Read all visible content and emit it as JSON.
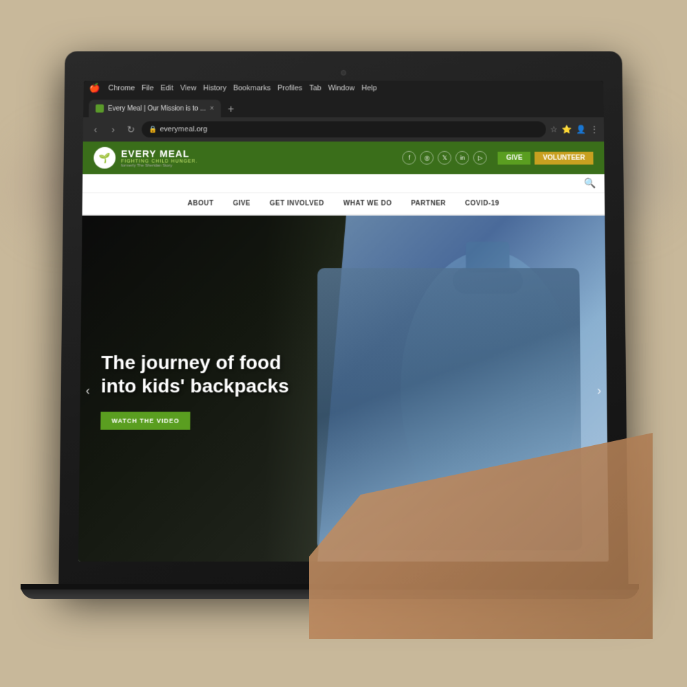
{
  "scene": {
    "background_color": "#c8b89a"
  },
  "mac_menubar": {
    "apple_symbol": "🍎",
    "items": [
      "Chrome",
      "File",
      "Edit",
      "View",
      "History",
      "Bookmarks",
      "Profiles",
      "Tab",
      "Window",
      "Help"
    ]
  },
  "browser": {
    "tab_title": "Every Meal | Our Mission is to ...",
    "tab_close": "×",
    "tab_new": "+",
    "address": "everymeal.org",
    "nav_back": "‹",
    "nav_forward": "›",
    "nav_reload": "↻"
  },
  "website": {
    "logo": {
      "icon": "🌱",
      "name": "EVERY MEAL",
      "tagline": "FIGHTING CHILD HUNGER.",
      "sub": "formerly The Sheridan Story"
    },
    "social_icons": [
      "f",
      "📷",
      "𝕏",
      "in",
      "♪"
    ],
    "header_buttons": {
      "give": "GIVE",
      "volunteer": "VOLUNTEER"
    },
    "nav_items": [
      "ABOUT",
      "GIVE",
      "GET INVOLVED",
      "WHAT WE DO",
      "PARTNER",
      "COVID-19"
    ],
    "hero": {
      "title": "The journey of food into kids' backpacks",
      "cta_button": "WATCH THE VIDEO",
      "arrow_left": "‹",
      "arrow_right": "›"
    }
  },
  "colors": {
    "green_dark": "#3a6e1a",
    "green_medium": "#5a9e20",
    "green_light": "#c8e870",
    "gold": "#c8a020",
    "nav_bg": "#ffffff",
    "hero_overlay": "rgba(0,0,0,0.7)"
  }
}
